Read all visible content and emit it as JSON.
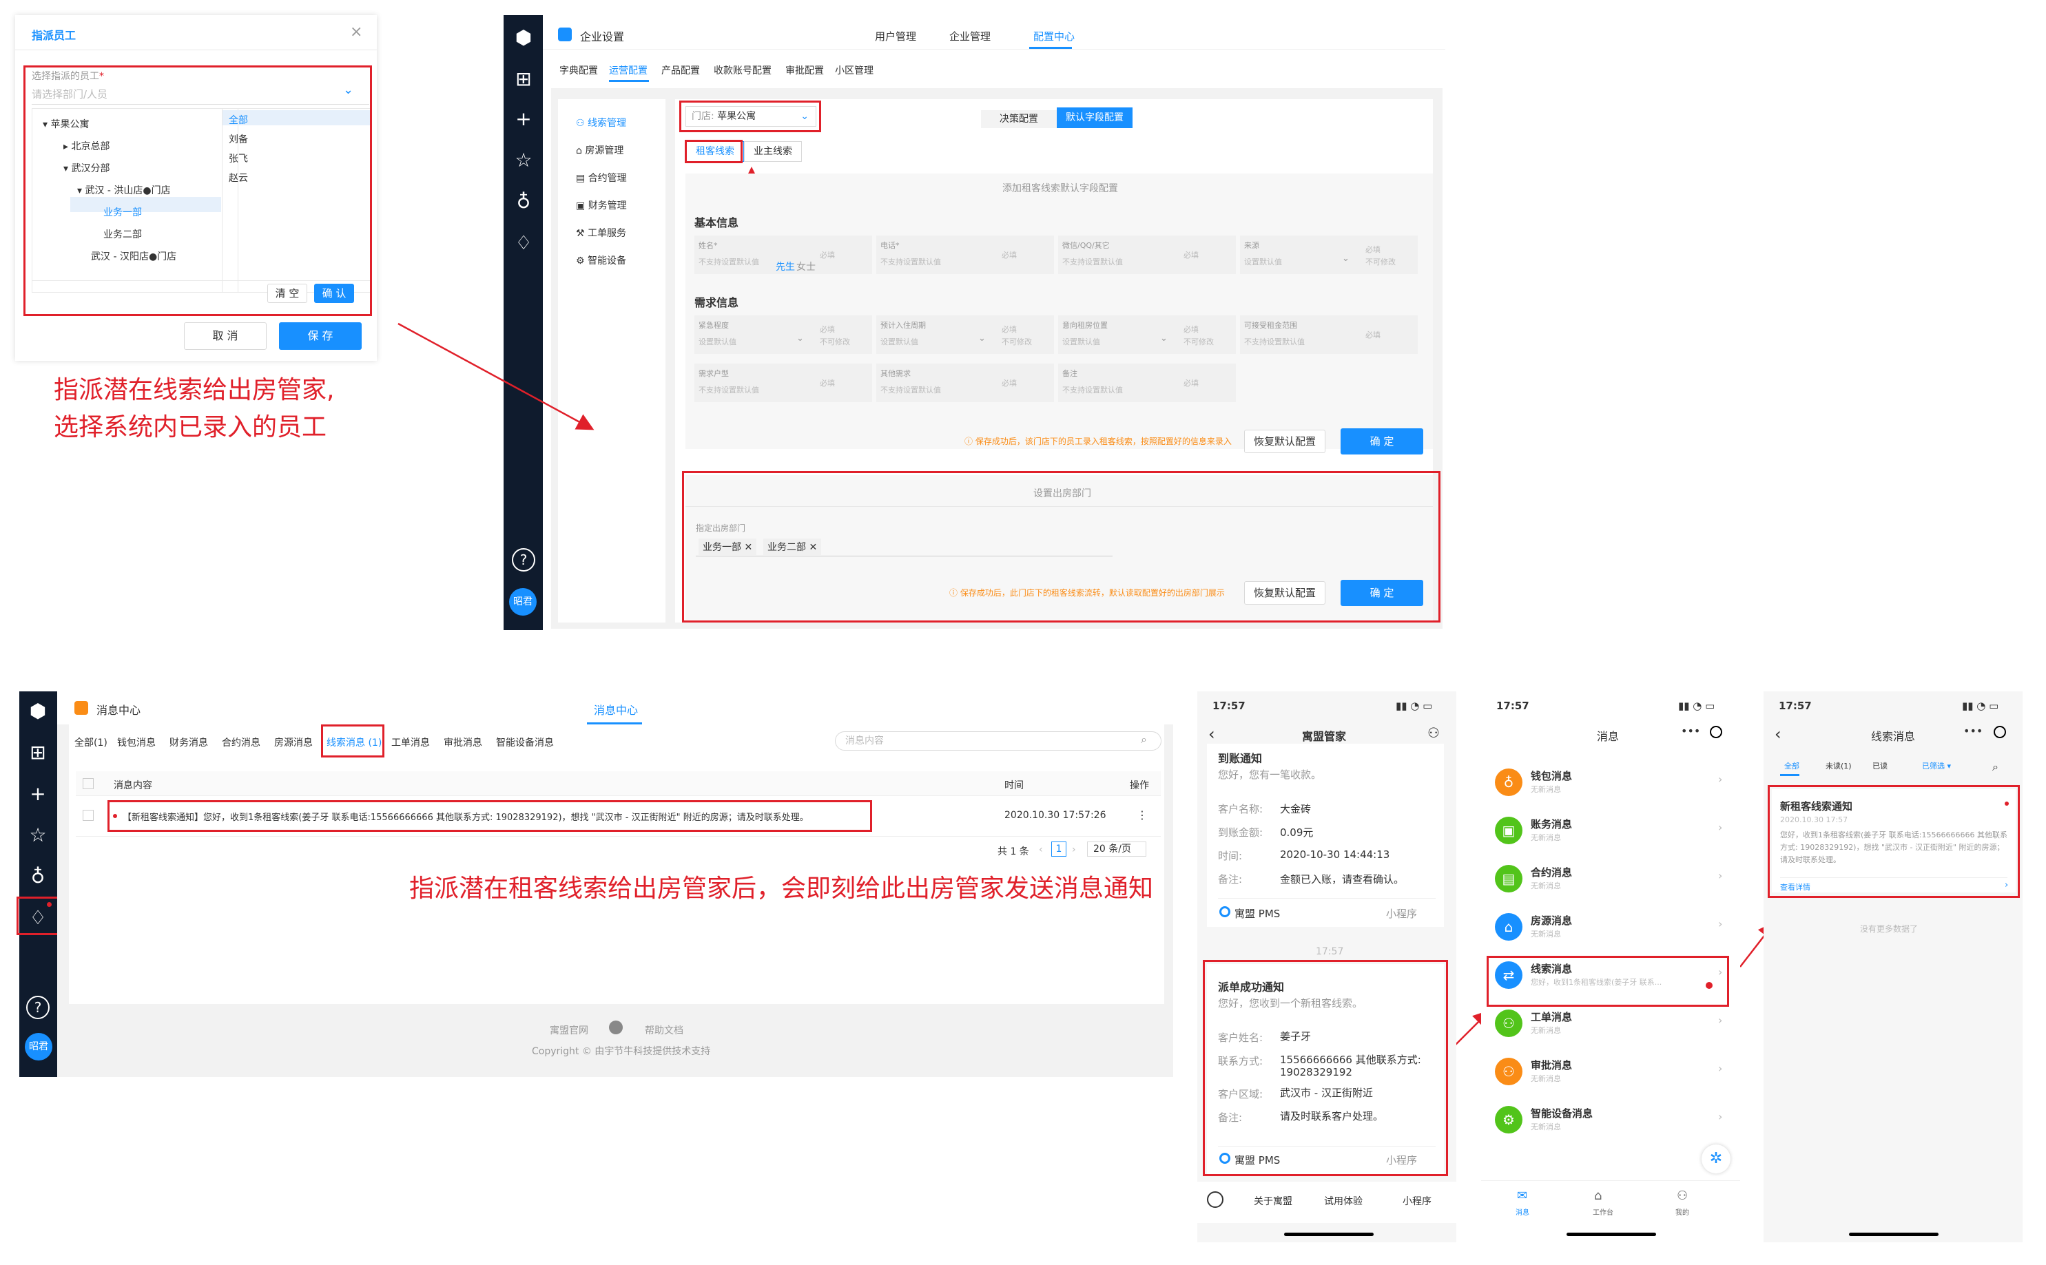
{
  "assign_dialog": {
    "title": "指派员工",
    "close": "×",
    "field_label": "选择指派的员工",
    "required_mark": "*",
    "placeholder": "请选择部门/人员",
    "tree": [
      "苹果公寓",
      "北京总部",
      "武汉分部",
      "武汉 - 洪山店●门店",
      "业务一部",
      "业务二部",
      "武汉 - 汉阳店●门店"
    ],
    "people": [
      "全部",
      "刘备",
      "张飞",
      "赵云"
    ],
    "clear": "清 空",
    "confirm": "确 认",
    "cancel": "取 消",
    "save": "保 存"
  },
  "annotations": {
    "a1_line1": "指派潜在线索给出房管家,",
    "a1_line2": "选择系统内已录入的员工",
    "a2": "指派潜在租客线索给出房管家后，会即刻给此出房管家发送消息通知"
  },
  "settings": {
    "title": "企业设置",
    "top_tabs": [
      "用户管理",
      "企业管理",
      "配置中心"
    ],
    "sub_tabs": [
      "字典配置",
      "运营配置",
      "产品配置",
      "收款账号配置",
      "审批配置",
      "小区管理"
    ],
    "menu": [
      "线索管理",
      "房源管理",
      "合约管理",
      "财务管理",
      "工单服务",
      "智能设备"
    ],
    "store_label": "门店:",
    "store_value": "苹果公寓",
    "config_tabs": [
      "决策配置",
      "默认字段配置"
    ],
    "clue_tabs": [
      "租客线索",
      "业主线索"
    ],
    "section_title": "添加租客线索默认字段配置",
    "basic_info": "基本信息",
    "demand_info": "需求信息",
    "gender_opts": [
      "先生",
      "女士"
    ],
    "basic_fields": [
      {
        "label": "姓名*",
        "value": "不支持设置默认值",
        "opt": "必填"
      },
      {
        "label": "电话*",
        "value": "不支持设置默认值",
        "opt": "必填"
      },
      {
        "label": "微信/QQ/其它",
        "value": "不支持设置默认值",
        "opt": "必填"
      },
      {
        "label": "来源",
        "value": "设置默认值",
        "opt": "必填",
        "opt2": "不可修改"
      }
    ],
    "demand_fields": [
      {
        "label": "紧急程度",
        "value": "设置默认值",
        "opt": "必填",
        "opt2": "不可修改"
      },
      {
        "label": "预计入住周期",
        "value": "设置默认值",
        "opt": "必填",
        "opt2": "不可修改"
      },
      {
        "label": "意向租房位置",
        "value": "设置默认值",
        "opt": "必填",
        "opt2": "不可修改"
      },
      {
        "label": "可接受租金范围",
        "value": "不支持设置默认值",
        "opt": "必填"
      },
      {
        "label": "需求户型",
        "value": "不支持设置默认值",
        "opt": "必填"
      },
      {
        "label": "其他需求",
        "value": "不支持设置默认值",
        "opt": "必填"
      },
      {
        "label": "备注",
        "value": "不支持设置默认值",
        "opt": "必填"
      }
    ],
    "tip1": "ⓘ 保存成功后，该门店下的员工录入租客线索，按照配置好的信息来录入",
    "restore": "恢复默认配置",
    "ok": "确 定",
    "dept_section": "设置出房部门",
    "dept_label": "指定出房部门",
    "dept_tags": [
      "业务一部",
      "业务二部"
    ],
    "tip2": "ⓘ 保存成功后，此门店下的租客线索流转，默认读取配置好的出房部门展示",
    "help": "?",
    "user": "昭君"
  },
  "msg_center": {
    "title": "消息中心",
    "tab_active": "消息中心",
    "filters": [
      "全部(1)",
      "钱包消息",
      "财务消息",
      "合约消息",
      "房源消息",
      "线索消息 (1)",
      "工单消息",
      "审批消息",
      "智能设备消息"
    ],
    "search_placeholder": "消息内容",
    "col_content": "消息内容",
    "col_time": "时间",
    "col_action": "操作",
    "row_text": "【新租客线索通知】您好，收到1条租客线索(姜子牙 联系电话:15566666666 其他联系方式: 19028329192)，想找 \"武汉市 - 汉正街附近\" 附近的房源；请及时联系处理。",
    "row_time": "2020.10.30 17:57:26",
    "row_action": "⋮",
    "pager_total": "共 1 条",
    "pager_page": "1",
    "pager_size": "20 条/页",
    "footer_links": [
      "寓盟官网",
      "帮助文档"
    ],
    "copyright": "Copyright © 由宇节牛科技提供技术支持",
    "user": "昭君"
  },
  "phone1": {
    "time": "17:57",
    "title": "寓盟管家",
    "notice1_title": "到账通知",
    "notice1_sub": "您好，您有一笔收款。",
    "n1_rows": [
      [
        "客户名称:",
        "大金砖"
      ],
      [
        "到账金额:",
        "0.09元"
      ],
      [
        "时间:",
        "2020-10-30 14:44:13"
      ],
      [
        "备注:",
        "金额已入账，请查看确认。"
      ]
    ],
    "brand": "寓盟 PMS",
    "mini": "小程序",
    "ts": "17:57",
    "notice2_title": "派单成功通知",
    "notice2_sub": "您好，您收到一个新租客线索。",
    "n2_rows": [
      [
        "客户姓名:",
        "姜子牙"
      ],
      [
        "联系方式:",
        "15566666666 其他联系方式: 19028329192"
      ],
      [
        "客户区域:",
        "武汉市 - 汉正街附近"
      ],
      [
        "备注:",
        "请及时联系客户处理。"
      ]
    ],
    "bottom": [
      "关于寓盟",
      "试用体验",
      "小程序"
    ]
  },
  "phone2": {
    "time": "17:57",
    "title": "消息",
    "items": [
      {
        "name": "钱包消息",
        "sub": "无新消息"
      },
      {
        "name": "账务消息",
        "sub": "无新消息"
      },
      {
        "name": "合约消息",
        "sub": "无新消息"
      },
      {
        "name": "房源消息",
        "sub": "无新消息"
      },
      {
        "name": "线索消息",
        "sub": "您好，收到1条租客线索(姜子牙 联系..."
      },
      {
        "name": "工单消息",
        "sub": "无新消息"
      },
      {
        "name": "审批消息",
        "sub": "无新消息"
      },
      {
        "name": "智能设备消息",
        "sub": "无新消息"
      }
    ],
    "nav": [
      "消息",
      "工作台",
      "我的"
    ]
  },
  "phone3": {
    "time": "17:57",
    "title": "线索消息",
    "tabs": [
      "全部",
      "未读(1)",
      "已读",
      "已筛选 ▾"
    ],
    "card_title": "新租客线索通知",
    "card_time": "2020.10.30 17:57",
    "card_body": "您好，收到1条租客线索(姜子牙 联系电话:15566666666 其他联系方式: 19028329192)，想找 \"武汉市 - 汉正街附近\" 附近的房源；请及时联系处理。",
    "card_link": "查看详情",
    "no_more": "没有更多数据了"
  }
}
